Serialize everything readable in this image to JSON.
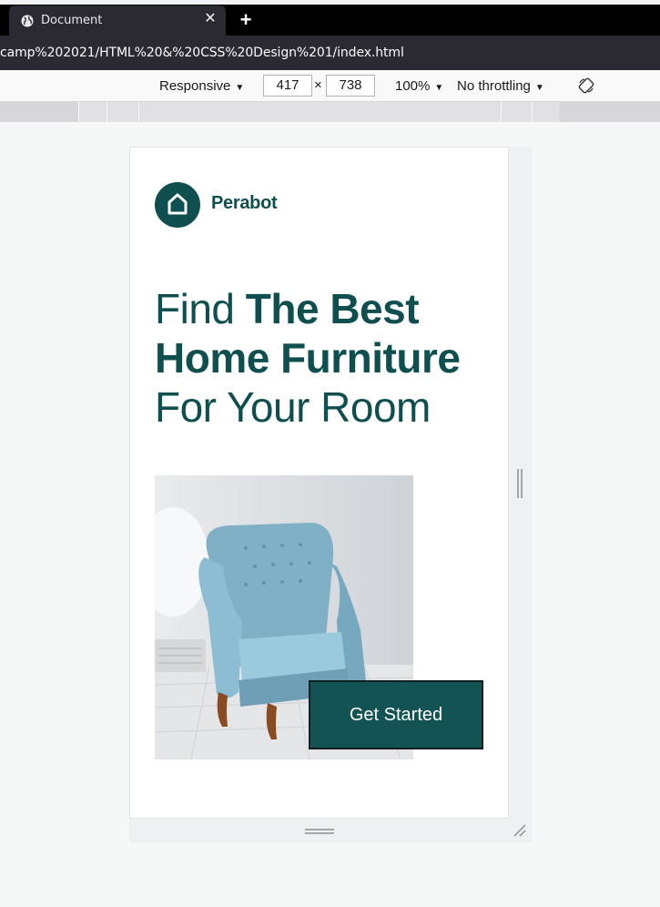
{
  "browser": {
    "tab_title": "Document",
    "tab_close_glyph": "✕",
    "new_tab_glyph": "+",
    "url": "camp%202021/HTML%20&%20CSS%20Design%201/index.html"
  },
  "devtools": {
    "device": "Responsive",
    "width": "417",
    "height": "738",
    "times_glyph": "×",
    "zoom": "100%",
    "throttling": "No throttling",
    "dropdown_glyph": "▼",
    "icons": [
      "globe-icon",
      "rotate-icon",
      "resize-corner-icon"
    ]
  },
  "page": {
    "brand": "Perabot",
    "brand_color": "#0f4f4f",
    "hero": {
      "line1_light": "Find ",
      "line1_bold": "The Best",
      "line2_bold": "Home Furniture",
      "line3_light": "For Your Room"
    },
    "image_subject": "armchair",
    "cta_label": "Get Started",
    "cta_color": "#135353"
  }
}
